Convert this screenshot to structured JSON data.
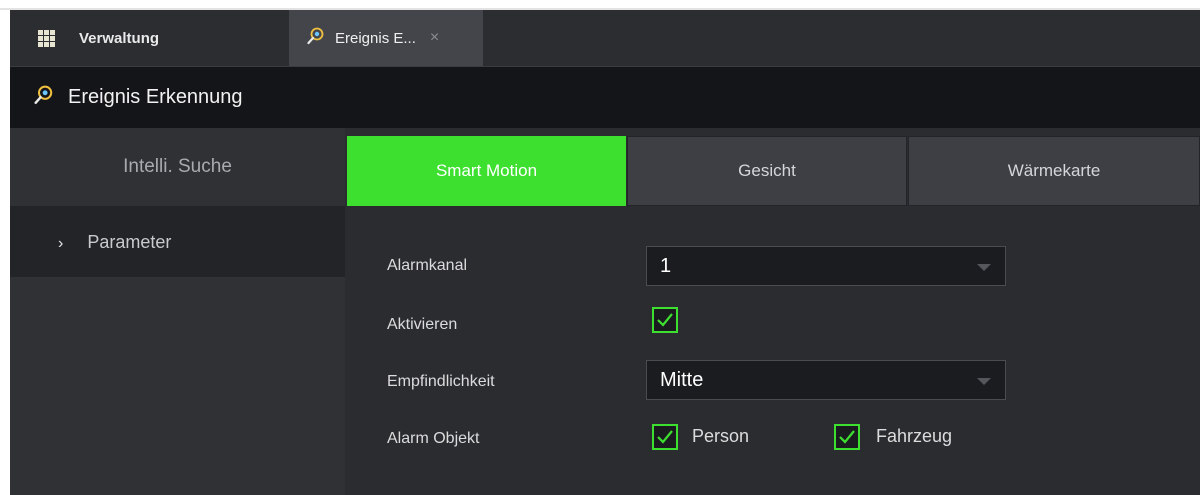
{
  "tabs": {
    "home_label": "Verwaltung",
    "event_label": "Ereignis E...",
    "close_glyph": "×"
  },
  "header": {
    "title": "Ereignis Erkennung"
  },
  "sidebar": {
    "heading": "Intelli. Suche",
    "items": [
      {
        "chevron": "›",
        "label": "Parameter"
      }
    ]
  },
  "content_tabs": [
    {
      "label": "Smart Motion",
      "active": true
    },
    {
      "label": "Gesicht",
      "active": false
    },
    {
      "label": "Wärmekarte",
      "active": false
    }
  ],
  "form": {
    "alarm_channel_label": "Alarmkanal",
    "alarm_channel_value": "1",
    "enable_label": "Aktivieren",
    "enable_checked": true,
    "sensitivity_label": "Empfindlichkeit",
    "sensitivity_value": "Mitte",
    "alarm_object_label": "Alarm Objekt",
    "objects": [
      {
        "label": "Person",
        "checked": true
      },
      {
        "label": "Fahrzeug",
        "checked": true
      }
    ]
  },
  "colors": {
    "accent": "#3ee030",
    "background": "#2a2c30",
    "header": "#141518"
  },
  "icons": [
    "grid-icon",
    "event-search-icon",
    "close-icon",
    "chevron-right-icon",
    "dropdown-caret-icon",
    "checkmark-icon"
  ]
}
